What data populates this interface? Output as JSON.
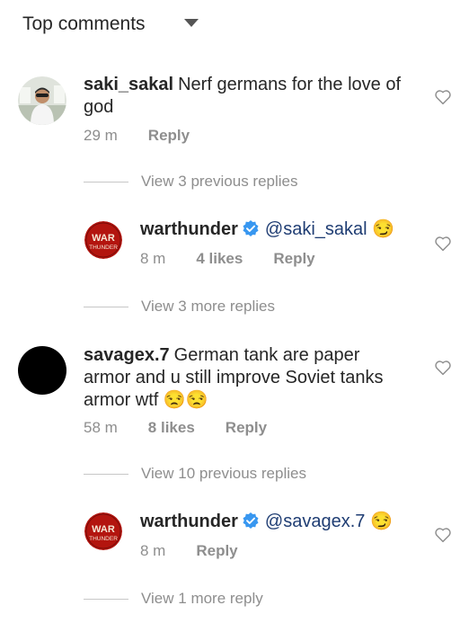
{
  "header": {
    "title": "Top comments"
  },
  "comments": [
    {
      "username": "saki_sakal",
      "text_line1": "Nerf germans for the love of",
      "text_line2": "god",
      "time": "29 m",
      "reply": "Reply",
      "view_previous": "View 3 previous replies",
      "reply_comment": {
        "username": "warthunder",
        "mention": "@saki_sakal",
        "emoji": "😏",
        "time": "8 m",
        "likes": "4 likes",
        "reply": "Reply"
      },
      "view_more": "View 3 more replies"
    },
    {
      "username": "savagex.7",
      "text_line1": "German tank are paper",
      "text_line2": "armor and u still improve Soviet tanks",
      "text_line3": "armor wtf",
      "emoji": "😒😒",
      "time": "58 m",
      "likes": "8 likes",
      "reply": "Reply",
      "view_previous": "View 10 previous replies",
      "reply_comment": {
        "username": "warthunder",
        "mention": "@savagex.7",
        "emoji": "😏",
        "time": "8 m",
        "reply": "Reply"
      },
      "view_more": "View 1 more reply"
    }
  ],
  "logo": {
    "line1": "WAR",
    "line2": "THUNDER"
  },
  "colors": {
    "mention": "#1f3d73",
    "verified": "#3897f0",
    "muted": "#8e8e8e",
    "logo_red": "#b3150f"
  }
}
